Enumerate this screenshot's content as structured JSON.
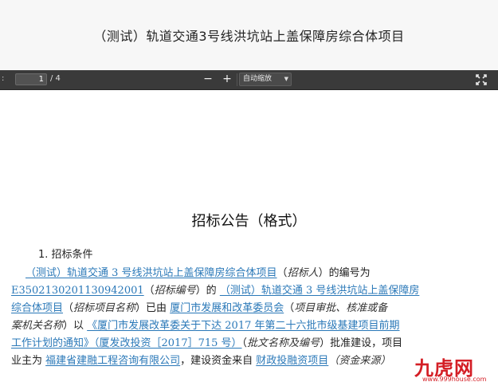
{
  "window": {
    "title": "（测试）轨道交通3号线洪坑站上盖保障房综合体项目"
  },
  "toolbar": {
    "page_label": ":",
    "page_current": "1",
    "page_total": "/ 4",
    "zoom_out": "−",
    "zoom_in": "+",
    "zoom_value": "自动缩放",
    "caret": "▼"
  },
  "doc": {
    "heading": "招标公告（格式）",
    "section": "1. 招标条件",
    "lines": [
      {
        "segments": [
          {
            "t": "（测试）轨道交通 3 号线洪坑站上盖保障房综合体项目",
            "s": "u"
          },
          {
            "t": "（",
            "s": ""
          },
          {
            "t": "招标人",
            "s": "i"
          },
          {
            "t": "）的编号为",
            "s": ""
          }
        ]
      },
      {
        "segments": [
          {
            "t": "E3502130201130942001",
            "s": "u"
          },
          {
            "t": "（",
            "s": ""
          },
          {
            "t": "招标编号",
            "s": "i"
          },
          {
            "t": "）的 ",
            "s": ""
          },
          {
            "t": "（测试）轨道交通 3 号线洪坑站上盖保障房",
            "s": "u"
          }
        ]
      },
      {
        "segments": [
          {
            "t": "综合体项目",
            "s": "u"
          },
          {
            "t": "（",
            "s": ""
          },
          {
            "t": "招标项目名称",
            "s": "i"
          },
          {
            "t": "）已由 ",
            "s": ""
          },
          {
            "t": "厦门市发展和改革委员会",
            "s": "u"
          },
          {
            "t": "（",
            "s": ""
          },
          {
            "t": "项目审批、核准或备",
            "s": "i"
          }
        ]
      },
      {
        "segments": [
          {
            "t": "案机关名称",
            "s": "i"
          },
          {
            "t": "）以 ",
            "s": ""
          },
          {
            "t": "《厦门市发展改革委关于下达 2017 年第二十六批市级基建项目前期",
            "s": "u"
          }
        ]
      },
      {
        "segments": [
          {
            "t": "工作计划的通知》（厦发改投资［2017］715 号）",
            "s": "u"
          },
          {
            "t": "（",
            "s": ""
          },
          {
            "t": "批文名称及编号",
            "s": "i"
          },
          {
            "t": "）批准建设，项目",
            "s": ""
          }
        ]
      },
      {
        "segments": [
          {
            "t": "业主为 ",
            "s": ""
          },
          {
            "t": "福建省建融工程咨询有限公司",
            "s": "u"
          },
          {
            "t": "，建设资金来自 ",
            "s": ""
          },
          {
            "t": "财政投融资项目",
            "s": "u"
          },
          {
            "t": "（资金来源）",
            "s": "i"
          }
        ]
      }
    ]
  },
  "watermark": {
    "logo": "九虎网",
    "url": "www.999house.com"
  }
}
